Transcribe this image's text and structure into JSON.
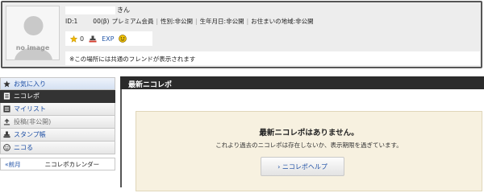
{
  "profile": {
    "avatar_text": "no image",
    "name_suffix": "きん",
    "id_prefix": "ID:1",
    "id_suffix": "00(β)",
    "premium": "プレミアム会員",
    "gender": "性別:非公開",
    "birthday": "生年月日:非公開",
    "region": "お住まいの地域:非公開",
    "stats": {
      "stars": "0",
      "exp_label": "EXP"
    },
    "friend_note": "※この場所には共通のフレンドが表示されます"
  },
  "sidebar": {
    "items": [
      {
        "label": "お気に入り",
        "icon": "star-icon"
      },
      {
        "label": "ニコレポ",
        "icon": "document-icon"
      },
      {
        "label": "マイリスト",
        "icon": "list-icon"
      },
      {
        "label": "投稿(非公開)",
        "icon": "upload-icon"
      },
      {
        "label": "スタンプ帳",
        "icon": "stamp-icon"
      },
      {
        "label": "ニコる",
        "icon": "nicoru-icon"
      }
    ],
    "calendar": {
      "prev_label": "«前月",
      "title": "ニコレポカレンダー"
    }
  },
  "main": {
    "title": "最新ニコレポ",
    "empty_title": "最新ニコレポはありません。",
    "empty_desc": "これより過去のニコレポは存在しないか、表示期限を過ぎています。",
    "help_label": "› ニコレポヘルプ"
  },
  "colors": {
    "link": "#1d4fa5",
    "header_dark": "#2b2b2b",
    "notice_bg": "#f7f1e0"
  }
}
